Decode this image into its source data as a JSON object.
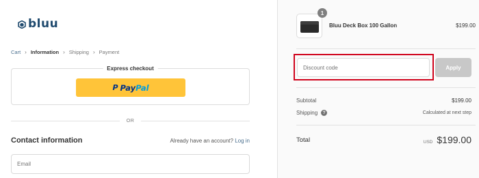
{
  "brand": {
    "name": "bluu",
    "accent": "#1f4a6e"
  },
  "breadcrumb": [
    {
      "label": "Cart",
      "state": "link"
    },
    {
      "label": "Information",
      "state": "current"
    },
    {
      "label": "Shipping",
      "state": "muted"
    },
    {
      "label": "Payment",
      "state": "muted"
    }
  ],
  "express": {
    "title": "Express checkout",
    "paypal": {
      "pay": "Pay",
      "pal": "Pal",
      "icon": "P"
    }
  },
  "divider_or": "OR",
  "contact": {
    "title": "Contact information",
    "account_prompt": "Already have an account?",
    "login_label": "Log in",
    "email_placeholder": "Email"
  },
  "order": {
    "item": {
      "name": "Bluu Deck Box 100 Gallon",
      "price": "$199.00",
      "quantity": "1"
    },
    "discount": {
      "placeholder": "Discount code",
      "apply_label": "Apply"
    },
    "subtotal_label": "Subtotal",
    "subtotal_value": "$199.00",
    "shipping_label": "Shipping",
    "shipping_value": "Calculated at next step",
    "total_label": "Total",
    "currency": "USD",
    "total_value": "$199.00"
  },
  "colors": {
    "paypal_yellow": "#ffc439",
    "highlight_red": "#d0021b",
    "apply_disabled": "#c8c8c8"
  }
}
